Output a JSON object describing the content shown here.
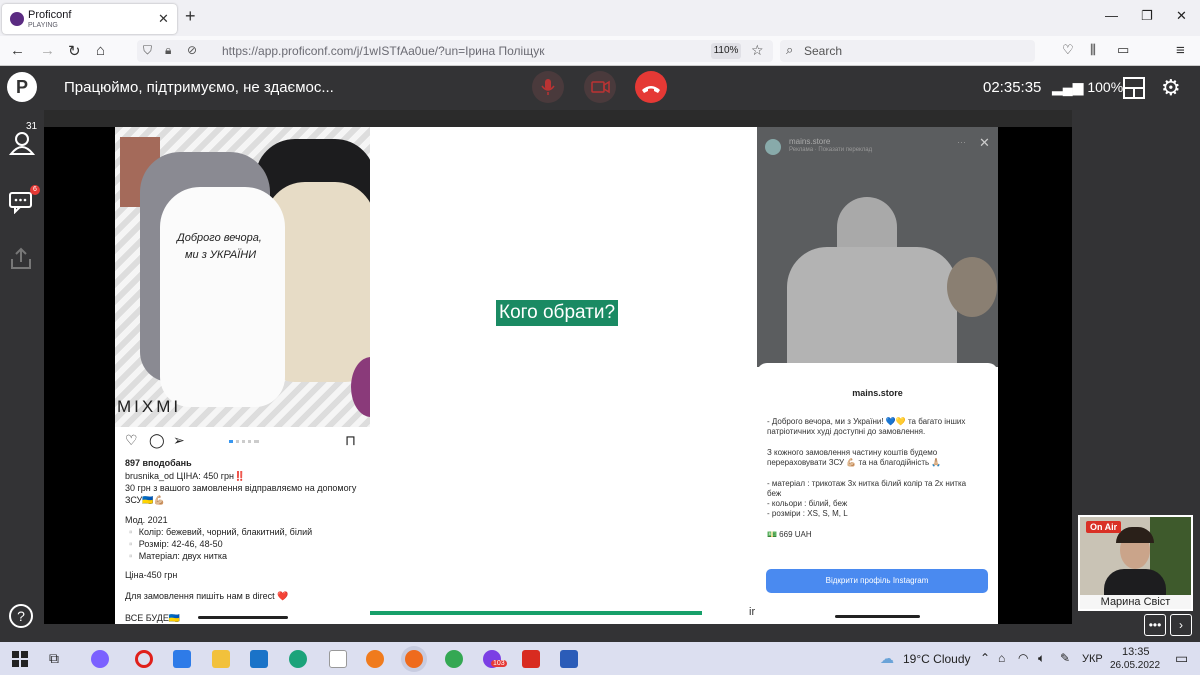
{
  "browser": {
    "tab_title": "Proficonf",
    "tab_status": "PLAYING",
    "new_tab": "+",
    "url": "https://app.proficonf.com/j/1wISTfAa0ue/?un=Ірина Поліщук",
    "zoom": "110%",
    "search_placeholder": "Search"
  },
  "conference": {
    "title": "Працюймо, підтримуємо, не здаємос...",
    "timer": "02:35:35",
    "signal": "100%",
    "participants_count": "31",
    "chat_badge": "6"
  },
  "slide": {
    "question": "Кого обрати?",
    "left_post": {
      "brand": "MIXMI",
      "likes": "897 вподобань",
      "caption_user": "brusnika_od ЦІНА: 450 грн‼️",
      "caption_line2": "30 грн з вашого замовлення відправляємо на допомогу",
      "caption_line3": "ЗСУ🇺🇦💪🏼",
      "model": "Мод. 2021",
      "colors": "▫️ Колір: бежевий, чорний, блакитний, білий",
      "sizes": "▫️ Розмір: 42-46, 48-50",
      "material": "▫️ Матеріал: двух нитка",
      "price": "Ціна-450 грн",
      "order": "Для замовлення пишіть нам в direct ❤️",
      "footer": "ВСЕ БУДЕ🇺🇦"
    },
    "sweatshirt_text1": "Доброго вечора,",
    "sweatshirt_text2": "ми з УКРАЇНИ",
    "ir": "ir",
    "right_post": {
      "store_top": "mains.store",
      "store_sub": "Реклама · Показати переклад",
      "store": "mains.store",
      "l1": "- Доброго вечора, ми з України! 💙💛 та багато інших",
      "l2": "патріотичних худі доступні до замовлення.",
      "l3": "З кожного замовлення частину коштів будемо",
      "l4": "перераховувати ЗСУ 💪🏼 та на благодійність 🙏🏼",
      "l5": "- матеріал : трикотаж 3х нитка білий колір та 2х нитка",
      "l6": "беж",
      "l7": "- кольори : білий, беж",
      "l8": "- розміри : XS, S, M, L",
      "price": "💵 669 UAH",
      "button": "Відкрити профіль Instagram"
    }
  },
  "camera": {
    "badge": "On Air",
    "name": "Марина Свіст"
  },
  "taskbar": {
    "weather": "19°C  Cloudy",
    "lang": "УКР",
    "time": "13:35",
    "date": "26.05.2022",
    "viber_badge": "103"
  }
}
